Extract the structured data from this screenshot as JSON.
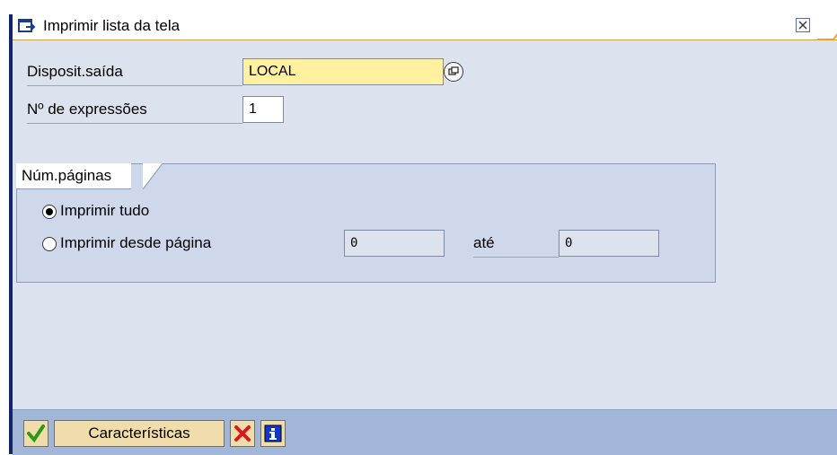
{
  "dialog": {
    "title": "Imprimir lista da tela"
  },
  "form": {
    "output_device": {
      "label": "Disposit.saída",
      "value": "LOCAL"
    },
    "copies": {
      "label": "Nº de expressões",
      "value": "1"
    }
  },
  "pages_group": {
    "title": "Núm.páginas",
    "options": [
      {
        "label": "Imprimir tudo",
        "selected": true
      },
      {
        "label": "Imprimir desde página",
        "selected": false
      }
    ],
    "from_value": "0",
    "to_label": "até",
    "to_value": "0"
  },
  "footer": {
    "characteristics_label": "Características",
    "icons": [
      "checkmark-icon",
      "cancel-x-icon",
      "info-icon"
    ]
  },
  "colors": {
    "accent_bar": "#14246b",
    "content_bg": "#dde3ee",
    "footer_bg": "#a2b7d8",
    "input_highlight": "#fff1a0",
    "button_bg": "#f1ddab"
  }
}
